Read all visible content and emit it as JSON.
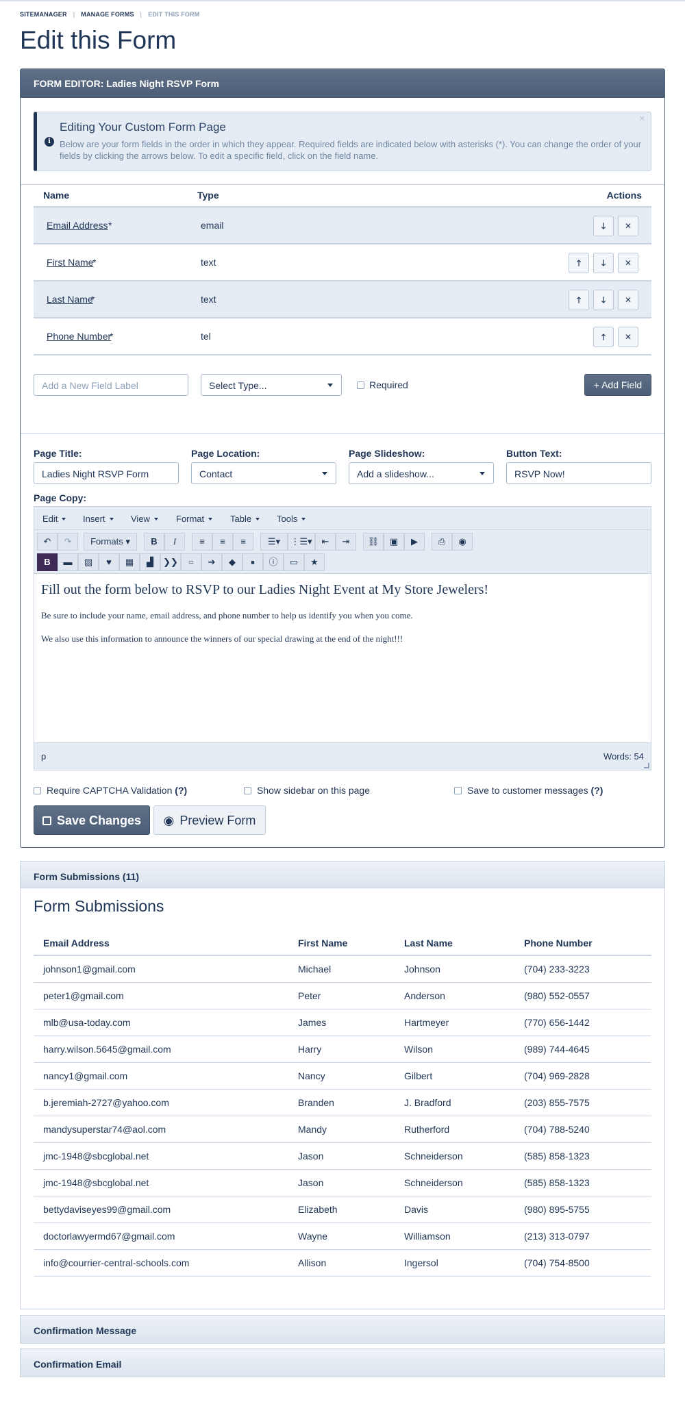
{
  "breadcrumb": {
    "item1": "SITEMANAGER",
    "item2": "MANAGE FORMS",
    "item3": "EDIT THIS FORM"
  },
  "page_title": "Edit this Form",
  "panel_title": "FORM EDITOR: Ladies Night RSVP Form",
  "alert": {
    "title": "Editing Your Custom Form Page",
    "text": "Below are your form fields in the order in which they appear. Required fields are indicated below with asterisks (*). You can change the order of your fields by clicking the arrows below. To edit a specific field, click on the field name.",
    "info_icon": "info-circle-icon",
    "close": "×"
  },
  "fields_table": {
    "headers": {
      "name": "Name",
      "type": "Type",
      "actions": "Actions"
    },
    "rows": [
      {
        "name": "Email Address",
        "star": "*",
        "type": "email"
      },
      {
        "name": "First Name",
        "star": "*",
        "type": "text"
      },
      {
        "name": "Last Name",
        "star": "*",
        "type": "text"
      },
      {
        "name": "Phone Number",
        "star": "*",
        "type": "tel"
      }
    ],
    "icons": {
      "up": "🡑",
      "down": "🡓",
      "delete": "✕"
    }
  },
  "add_field": {
    "label_placeholder": "Add a New Field Label",
    "type_select": "Select Type...",
    "required_label": "Required",
    "button": "+ Add Field"
  },
  "page_settings": {
    "title_label": "Page Title:",
    "title_value": "Ladies Night RSVP Form",
    "location_label": "Page Location:",
    "location_value": "Contact",
    "slideshow_label": "Page Slideshow:",
    "slideshow_value": "Add a slideshow...",
    "button_label": "Button Text:",
    "button_value": "RSVP Now!",
    "copy_label": "Page Copy:"
  },
  "editor": {
    "menus": [
      "Edit",
      "Insert",
      "View",
      "Format",
      "Table",
      "Tools"
    ],
    "formats_label": "Formats",
    "content": {
      "heading": "Fill out the form below to RSVP to our Ladies Night Event at My Store Jewelers!",
      "p1": "Be sure to include your name, email address, and phone number to help us identify you when you come.",
      "p2": "We also use this information to announce the winners of our special drawing at the end of the night!!!"
    },
    "status_path": "p",
    "word_count": "Words: 54"
  },
  "options": {
    "captcha": "Require CAPTCHA Validation",
    "captcha_help": "(?)",
    "sidebar": "Show sidebar on this page",
    "save_messages": "Save to customer messages",
    "save_messages_help": "(?)"
  },
  "buttons": {
    "save": "Save Changes",
    "preview": "Preview Form"
  },
  "submissions": {
    "accordion": "Form Submissions (11)",
    "heading": "Form Submissions",
    "headers": {
      "email": "Email Address",
      "first": "First Name",
      "last": "Last Name",
      "phone": "Phone Number"
    },
    "rows": [
      {
        "email": "johnson1@gmail.com",
        "first": "Michael",
        "last": "Johnson",
        "phone": "(704) 233-3223"
      },
      {
        "email": "peter1@gmail.com",
        "first": "Peter",
        "last": "Anderson",
        "phone": "(980) 552-0557"
      },
      {
        "email": "mlb@usa-today.com",
        "first": "James",
        "last": "Hartmeyer",
        "phone": "(770) 656-1442"
      },
      {
        "email": "harry.wilson.5645@gmail.com",
        "first": "Harry",
        "last": "Wilson",
        "phone": "(989) 744-4645"
      },
      {
        "email": "nancy1@gmail.com",
        "first": "Nancy",
        "last": "Gilbert",
        "phone": "(704) 969-2828"
      },
      {
        "email": "b.jeremiah-2727@yahoo.com",
        "first": "Branden",
        "last": "J. Bradford",
        "phone": "(203) 855-7575"
      },
      {
        "email": "mandysuperstar74@aol.com",
        "first": "Mandy",
        "last": "Rutherford",
        "phone": "(704) 788-5240"
      },
      {
        "email": "jmc-1948@sbcglobal.net",
        "first": "Jason",
        "last": "Schneiderson",
        "phone": "(585) 858-1323"
      },
      {
        "email": "jmc-1948@sbcglobal.net",
        "first": "Jason",
        "last": "Schneiderson",
        "phone": "(585) 858-1323"
      },
      {
        "email": "bettydaviseyes99@gmail.com",
        "first": "Elizabeth",
        "last": "Davis",
        "phone": "(980) 895-5755"
      },
      {
        "email": "doctorlawyermd67@gmail.com",
        "first": "Wayne",
        "last": "Williamson",
        "phone": "(213) 313-0797"
      },
      {
        "email": "info@courrier-central-schools.com",
        "first": "Allison",
        "last": "Ingersol",
        "phone": "(704) 754-8500"
      }
    ]
  },
  "accordions": {
    "confirmation_message": "Confirmation Message",
    "confirmation_email": "Confirmation Email"
  },
  "colors": {
    "primary": "#1f3556",
    "header_bg": "#55677f",
    "row_alt": "#e6ecf4",
    "active_button": "#3d2a57"
  }
}
